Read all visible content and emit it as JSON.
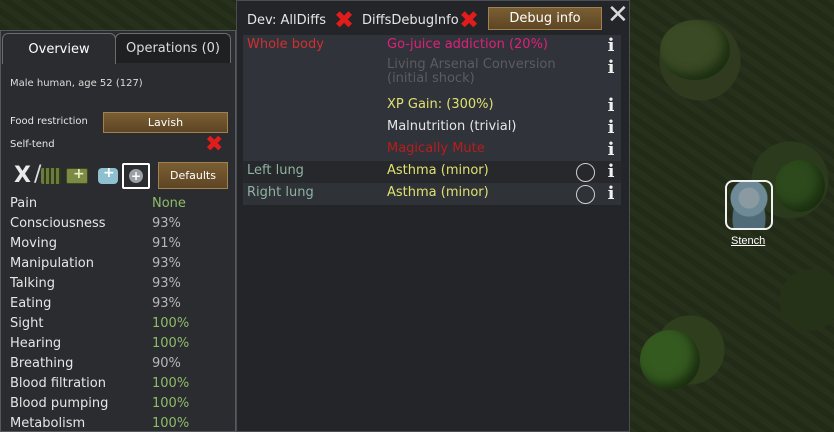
{
  "pawn": {
    "name": "Stench"
  },
  "left_panel": {
    "tabs": [
      {
        "label": "Overview",
        "active": true
      },
      {
        "label": "Operations (0)",
        "active": false
      }
    ],
    "subject": "Male human, age 52 (127)",
    "food_restriction": {
      "label": "Food restriction",
      "value": "Lavish"
    },
    "self_tend": {
      "label": "Self-tend",
      "enabled": false
    },
    "care_icons": [
      "no-care-icon",
      "no-meds-icon",
      "herbal-medicine-icon",
      "industrial-medicine-icon",
      "glitterworld-medicine-icon"
    ],
    "defaults_label": "Defaults",
    "capacities": [
      {
        "name": "Pain",
        "value": "None",
        "color": "#8fbc6a"
      },
      {
        "name": "Consciousness",
        "value": "93%",
        "color": "#b7b7b7"
      },
      {
        "name": "Moving",
        "value": "91%",
        "color": "#b7b7b7"
      },
      {
        "name": "Manipulation",
        "value": "93%",
        "color": "#b7b7b7"
      },
      {
        "name": "Talking",
        "value": "93%",
        "color": "#b7b7b7"
      },
      {
        "name": "Eating",
        "value": "93%",
        "color": "#b7b7b7"
      },
      {
        "name": "Sight",
        "value": "100%",
        "color": "#8fbc6a"
      },
      {
        "name": "Hearing",
        "value": "100%",
        "color": "#8fbc6a"
      },
      {
        "name": "Breathing",
        "value": "90%",
        "color": "#b7b7b7"
      },
      {
        "name": "Blood filtration",
        "value": "100%",
        "color": "#8fbc6a"
      },
      {
        "name": "Blood pumping",
        "value": "100%",
        "color": "#8fbc6a"
      },
      {
        "name": "Metabolism",
        "value": "100%",
        "color": "#8fbc6a"
      }
    ]
  },
  "debug_panel": {
    "dev_label": "Dev: AllDiffs",
    "diffs_label": "DiffsDebugInfo",
    "debug_button": "Debug info",
    "whole_body": {
      "part": "Whole body",
      "part_color": "#d03030",
      "hediffs": [
        {
          "label": "Go-juice addiction (20%)",
          "color": "#e0207a",
          "info": "i"
        },
        {
          "label": "Living Arsenal Conversion",
          "label2": "(initial shock)",
          "color": "#5a5c60",
          "info": "i"
        },
        {
          "label": "XP Gain: (300%)",
          "color": "#e0e070",
          "info": "i"
        },
        {
          "label": "Malnutrition (trivial)",
          "color": "#e6e6e6",
          "info": "i"
        },
        {
          "label": "Magically Mute",
          "color": "#b81d1d",
          "info": "i"
        }
      ]
    },
    "parts": [
      {
        "part": "Left lung",
        "hediff": "Asthma (minor)",
        "part_color": "#8fb3a0",
        "hediff_color": "#e0e070",
        "info": "i"
      },
      {
        "part": "Right lung",
        "hediff": "Asthma (minor)",
        "part_color": "#8fb3a0",
        "hediff_color": "#e0e070",
        "info": "i"
      }
    ]
  }
}
